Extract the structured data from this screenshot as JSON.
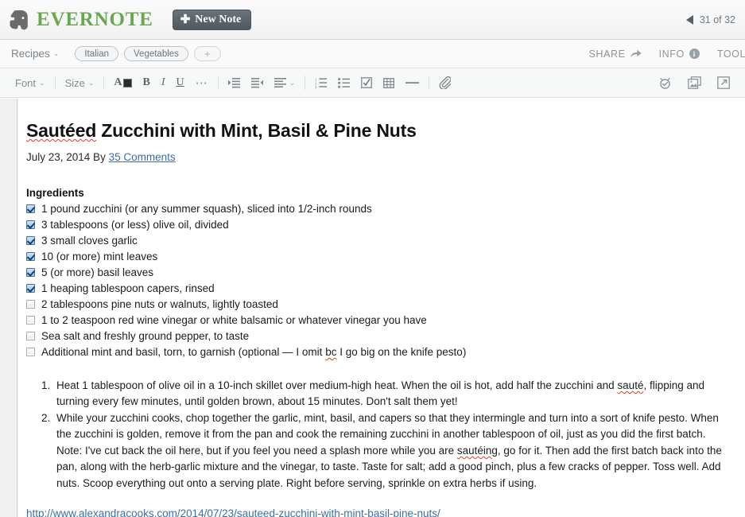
{
  "header": {
    "brand_name": "EVERNOTE",
    "logo_icon": "evernote-elephant-icon",
    "new_note_label": "New Note",
    "new_note_plus": "✚",
    "pager_prev_icon": "triangle-left-icon",
    "pager_text": "31 of 32"
  },
  "tagbar": {
    "notebook_label": "Recipes",
    "notebook_caret": "⌄",
    "tags": [
      {
        "label": "Italian"
      },
      {
        "label": "Vegetables"
      }
    ],
    "add_tag_label": "+",
    "actions": [
      {
        "label": "SHARE",
        "icon": "share-arrow-icon",
        "glyph": "➞"
      },
      {
        "label": "INFO",
        "icon": "info-circle-icon",
        "glyph": "i"
      },
      {
        "label": "TOOLS",
        "icon": "",
        "glyph": ""
      }
    ]
  },
  "formatbar": {
    "font_label": "Font",
    "font_caret": "⌄",
    "size_label": "Size",
    "size_caret": "⌄",
    "text_color_letter": "A",
    "text_color_swatch": "#2b2b2b",
    "bold_label": "B",
    "italic_label": "I",
    "underline_label": "U",
    "more_label": "⋯",
    "align_caret": "⌄",
    "tools": [
      "indent-increase-icon",
      "indent-decrease-icon",
      "align-left-icon",
      "numbered-list-icon",
      "bullet-list-icon",
      "checkbox-list-icon",
      "table-icon",
      "horizontal-rule-icon",
      "attachment-paperclip-icon"
    ],
    "right_tools": [
      "reminder-alarm-clock-icon",
      "duplicate-note-icon",
      "expand-note-icon"
    ]
  },
  "note": {
    "title_part_spell": "Sautéed",
    "title_rest": " Zucchini with Mint, Basil & Pine Nuts",
    "byline_date": "July 23, 2014 By ",
    "byline_link": "35 Comments",
    "ingredients_heading": "Ingredients",
    "ingredients": [
      {
        "checked": true,
        "text": "1 pound zucchini (or any summer squash), sliced into 1/2-inch rounds"
      },
      {
        "checked": true,
        "text": "3 tablespoons (or less) olive oil, divided"
      },
      {
        "checked": true,
        "text": "3 small cloves garlic"
      },
      {
        "checked": true,
        "text": "10 (or more) mint leaves"
      },
      {
        "checked": true,
        "text": "5 (or more) basil leaves"
      },
      {
        "checked": true,
        "text": "1 heaping tablespoon capers, rinsed"
      },
      {
        "checked": false,
        "text": "2 tablespoons pine nuts or walnuts, lightly toasted"
      },
      {
        "checked": false,
        "text": "1 to 2 teaspoon red wine vinegar or white balsamic or whatever vinegar you have"
      },
      {
        "checked": false,
        "text": "Sea salt and freshly ground pepper, to taste"
      },
      {
        "checked": false,
        "text": "Additional mint and basil, torn, to garnish (optional — I omit bc I go big on the knife pesto)"
      }
    ],
    "steps": [
      "Heat 1 tablespoon of olive oil in a 10-inch skillet over medium-high heat. When the oil is hot, add half the zucchini and sauté, flipping and turning every few minutes, until golden brown, about 15 minutes. Don't salt them yet!",
      "While your zucchini cooks, chop together the garlic, mint, basil, and capers so that they intermingle and turn into a sort of knife pesto. When the zucchini is golden, remove it from the pan and cook the remaining zucchini in another tablespoon of oil, just as you did the first batch. Note: I've cut back the oil here, but if you feel you need a splash more while you are sautéing, go for it. Then add the first batch back into the pan, along with the herb-garlic mixture and the vinegar, to taste. Taste for salt; add a good pinch, plus a few cracks of pepper. Toss well. Add nuts. Scoop everything out onto a serving plate. Right before serving, sprinkle on extra herbs if using."
    ],
    "source_url": "http://www.alexandracooks.com/2014/07/23/sauteed-zucchini-with-mint-basil-pine-nuts/"
  },
  "colors": {
    "brand_green": "#6aa84f",
    "link_blue": "#3a6ea5",
    "spellcheck_red": "#e03b29",
    "button_dark": "#4f585f"
  }
}
